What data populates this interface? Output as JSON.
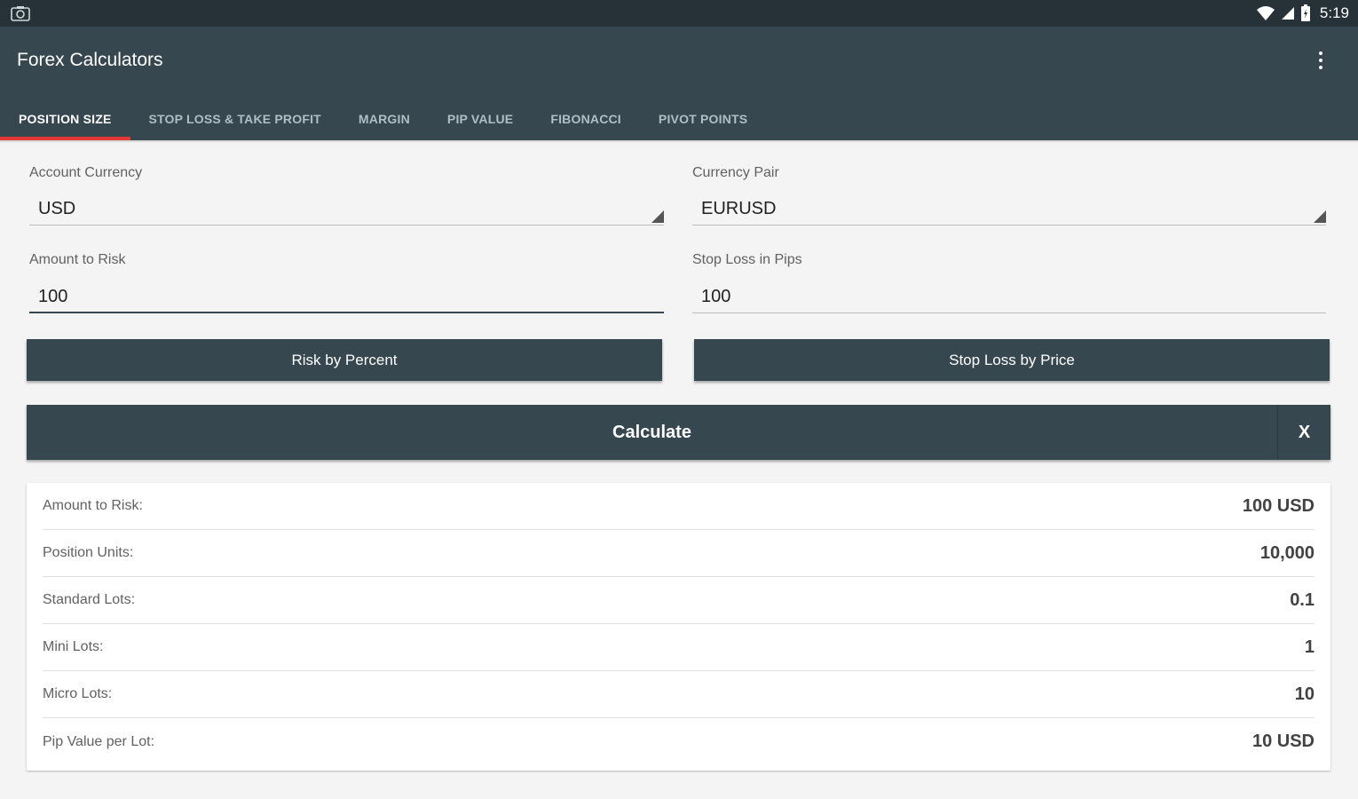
{
  "status_bar": {
    "time": "5:19",
    "icons": [
      "screenshot-icon",
      "wifi-icon",
      "signal-icon",
      "battery-icon"
    ]
  },
  "app_bar": {
    "title": "Forex Calculators",
    "overflow_icon": "more-vert-icon"
  },
  "tabs": [
    {
      "label": "POSITION SIZE",
      "active": true
    },
    {
      "label": "STOP LOSS & TAKE PROFIT",
      "active": false
    },
    {
      "label": "MARGIN",
      "active": false
    },
    {
      "label": "PIP VALUE",
      "active": false
    },
    {
      "label": "FIBONACCI",
      "active": false
    },
    {
      "label": "PIVOT POINTS",
      "active": false
    }
  ],
  "form": {
    "account_currency": {
      "label": "Account Currency",
      "value": "USD"
    },
    "currency_pair": {
      "label": "Currency Pair",
      "value": "EURUSD"
    },
    "amount_to_risk": {
      "label": "Amount to Risk",
      "value": "100"
    },
    "stop_loss_pips": {
      "label": "Stop Loss in Pips",
      "value": "100"
    },
    "risk_by_percent_label": "Risk by Percent",
    "stop_loss_by_price_label": "Stop Loss by Price",
    "calculate_label": "Calculate",
    "clear_label": "X"
  },
  "results": [
    {
      "label": "Amount to Risk:",
      "value": "100 USD"
    },
    {
      "label": "Position Units:",
      "value": "10,000"
    },
    {
      "label": "Standard Lots:",
      "value": "0.1"
    },
    {
      "label": "Mini Lots:",
      "value": "1"
    },
    {
      "label": "Micro Lots:",
      "value": "10"
    },
    {
      "label": "Pip Value per Lot:",
      "value": "10 USD"
    }
  ],
  "colors": {
    "app_bar": "#37474f",
    "status_bar": "#263238",
    "tab_indicator": "#e53935",
    "background": "#f4f4f4"
  }
}
